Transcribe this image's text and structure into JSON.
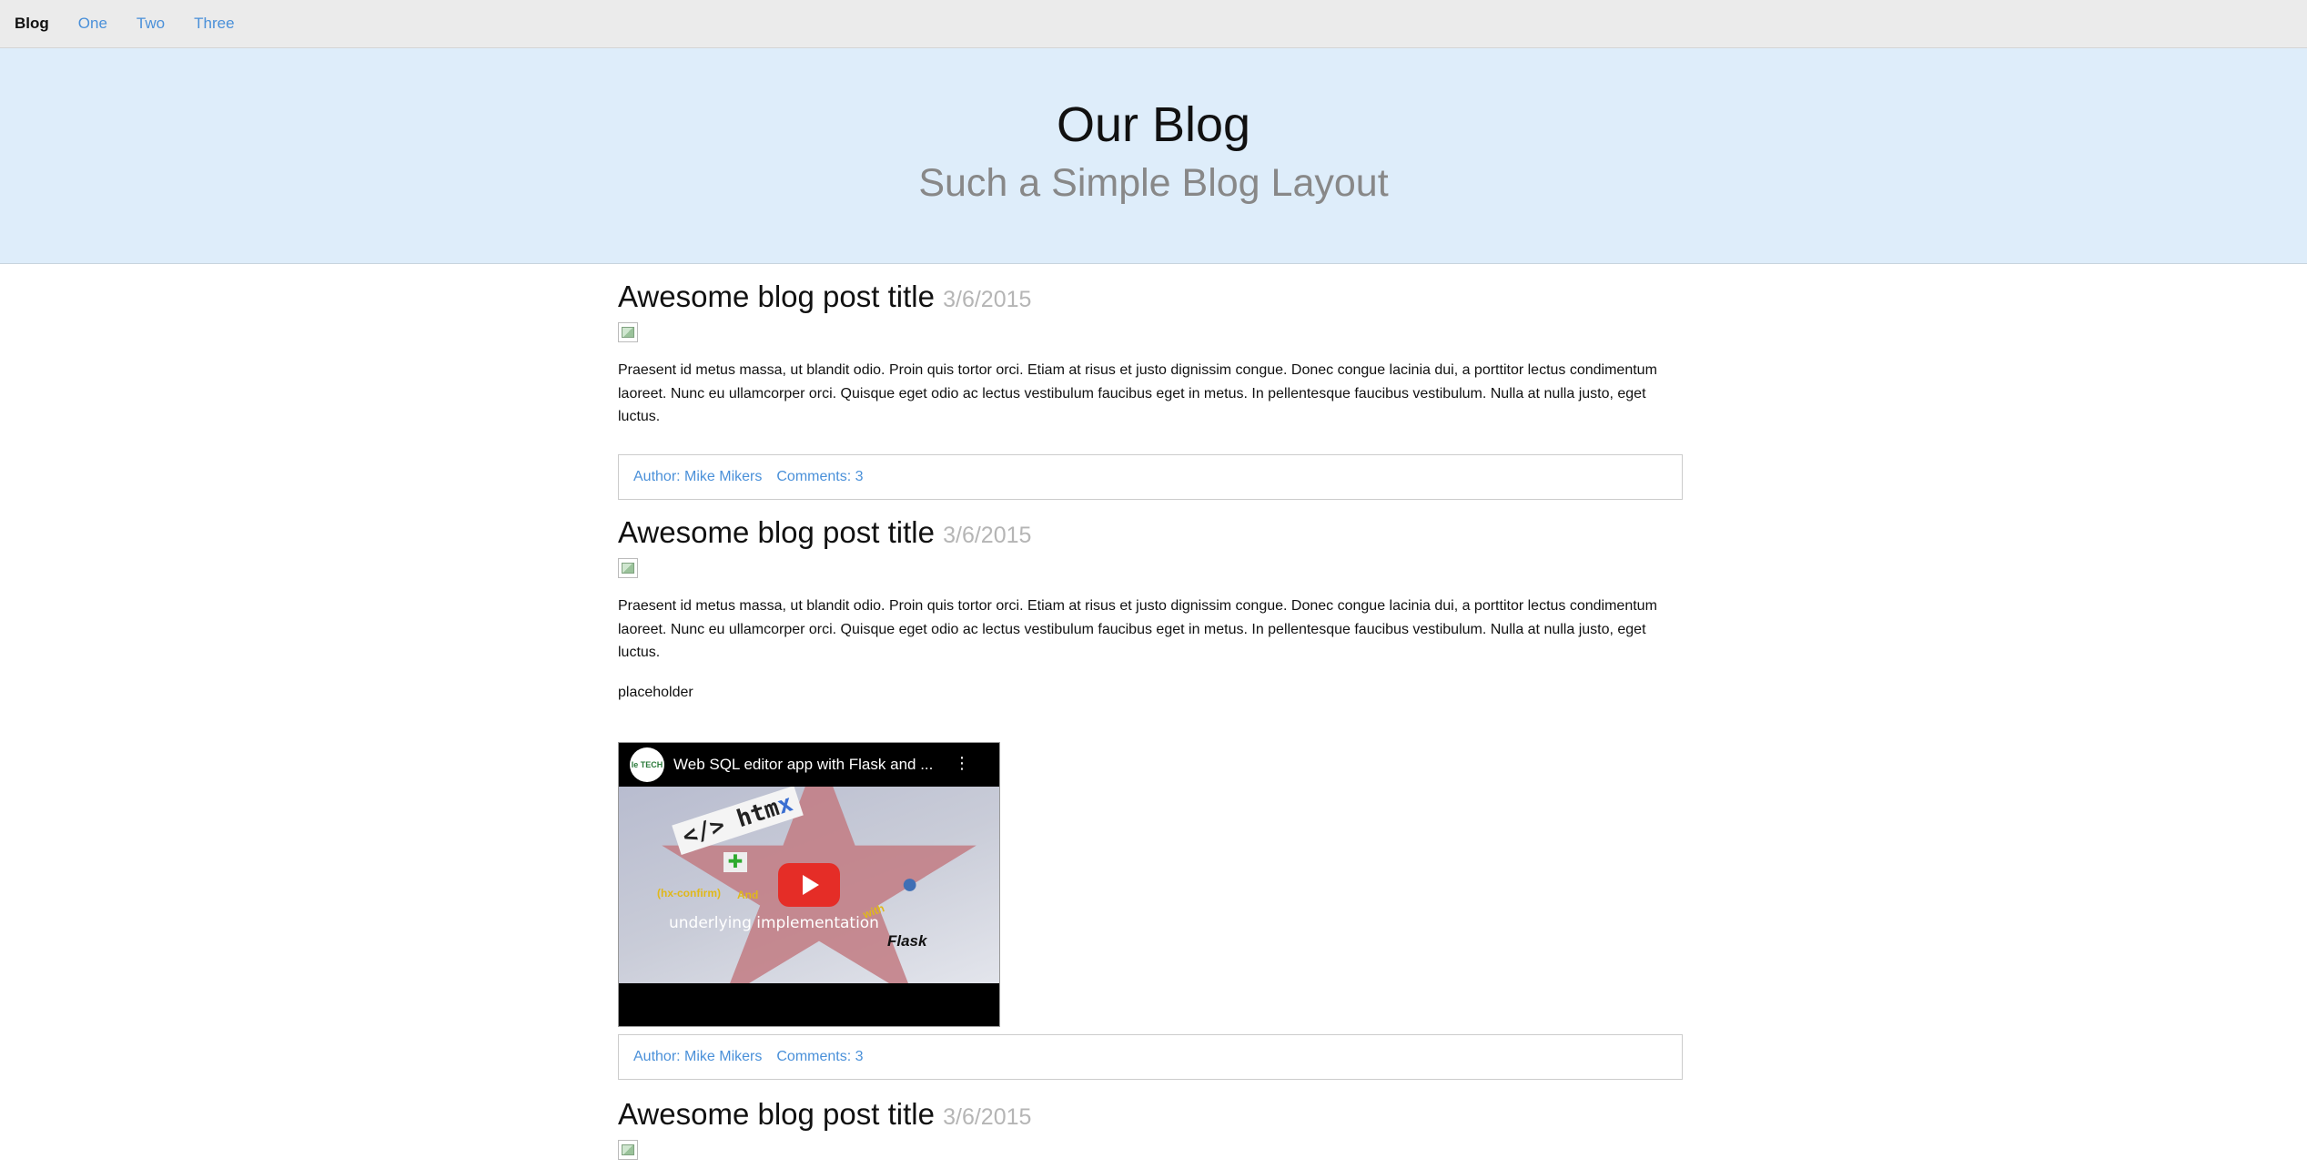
{
  "nav": {
    "brand": "Blog",
    "links": [
      "One",
      "Two",
      "Three"
    ]
  },
  "hero": {
    "title": "Our Blog",
    "subtitle": "Such a Simple Blog Layout"
  },
  "posts": [
    {
      "title": "Awesome blog post title",
      "date": "3/6/2015",
      "body": "Praesent id metus massa, ut blandit odio. Proin quis tortor orci. Etiam at risus et justo dignissim congue. Donec congue lacinia dui, a porttitor lectus condimentum laoreet. Nunc eu ullamcorper orci. Quisque eget odio ac lectus vestibulum faucibus eget in metus. In pellentesque faucibus vestibulum. Nulla at nulla justo, eget luctus.",
      "author": "Author: Mike Mikers",
      "comments": "Comments: 3"
    },
    {
      "title": "Awesome blog post title",
      "date": "3/6/2015",
      "body": "Praesent id metus massa, ut blandit odio. Proin quis tortor orci. Etiam at risus et justo dignissim congue. Donec congue lacinia dui, a porttitor lectus condimentum laoreet. Nunc eu ullamcorper orci. Quisque eget odio ac lectus vestibulum faucibus eget in metus. In pellentesque faucibus vestibulum. Nulla at nulla justo, eget luctus.",
      "placeholder": "placeholder",
      "video": {
        "title": "Web SQL editor app with Flask and ...",
        "channel_initials": "le TECH",
        "thumb_htmx": "</> htm",
        "thumb_htmx_x": "x",
        "thumb_hx_confirm": "(hx-confirm)",
        "thumb_and": "And",
        "thumb_with": "with",
        "thumb_caption": "underlying implementation",
        "thumb_flask": "Flask"
      },
      "author": "Author: Mike Mikers",
      "comments": "Comments: 3"
    },
    {
      "title": "Awesome blog post title",
      "date": "3/6/2015"
    }
  ]
}
